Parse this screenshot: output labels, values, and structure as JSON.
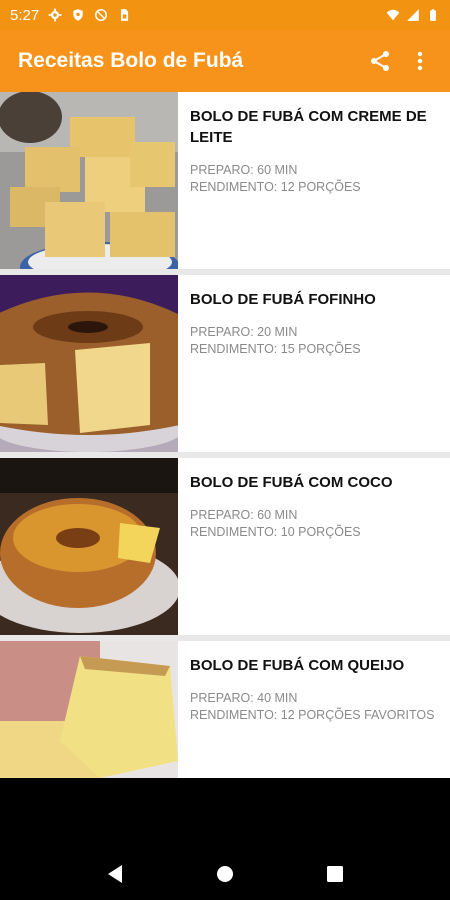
{
  "status": {
    "time": "5:27",
    "left_icons": [
      "gear-icon",
      "shield-icon",
      "no-disturb-icon",
      "sim-card-icon"
    ],
    "right_icons": [
      "wifi-icon",
      "signal-icon",
      "battery-icon"
    ]
  },
  "app_bar": {
    "title": "Receitas Bolo de Fubá",
    "actions": [
      "share-icon",
      "more-vert-icon"
    ],
    "color": "#f7931a"
  },
  "recipes": [
    {
      "title": "BOLO DE FUBÁ COM CREME DE LEITE",
      "preparo": "PREPARO: 60 MIN",
      "rendimento": "RENDIMENTO: 12 PORÇÕES"
    },
    {
      "title": "BOLO DE FUBÁ FOFINHO",
      "preparo": "PREPARO: 20 MIN",
      "rendimento": "RENDIMENTO: 15 PORÇÕES"
    },
    {
      "title": "BOLO DE FUBÁ COM COCO",
      "preparo": "PREPARO: 60 MIN",
      "rendimento": "RENDIMENTO: 10 PORÇÕES"
    },
    {
      "title": "BOLO DE FUBÁ COM QUEIJO",
      "preparo": "PREPARO: 40 MIN",
      "rendimento": "RENDIMENTO: 12 PORÇÕES FAVORITOS"
    }
  ],
  "nav": [
    "back-icon",
    "home-icon",
    "recents-icon"
  ]
}
